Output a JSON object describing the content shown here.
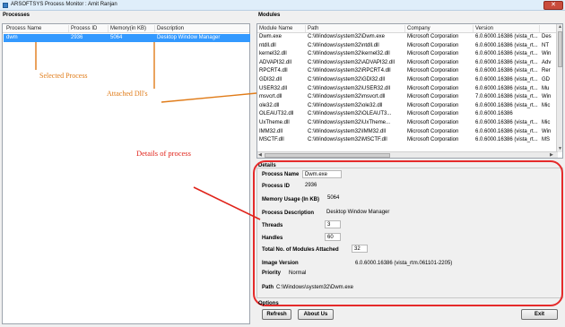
{
  "window": {
    "title": "ARSOFTSYS Process Monitor : Amit Ranjan",
    "close_label": "✕"
  },
  "processes": {
    "group_label": "Processes",
    "columns": [
      "Process Name",
      "Process ID",
      "Memory(in KB)",
      "Description"
    ],
    "rows": [
      {
        "name": "dwm",
        "pid": "2936",
        "memory": "5064",
        "description": "Desktop Window Manager",
        "selected": true
      }
    ]
  },
  "modules": {
    "group_label": "Modules",
    "columns": [
      "Module Name",
      "Path",
      "Company",
      "Version",
      ""
    ],
    "rows": [
      {
        "name": "Dwm.exe",
        "path": "C:\\Windows\\system32\\Dwm.exe",
        "company": "Microsoft Corporation",
        "version": "6.0.6000.16386 (vista_rt...",
        "extra": "Des"
      },
      {
        "name": "ntdll.dll",
        "path": "C:\\Windows\\system32\\ntdll.dll",
        "company": "Microsoft Corporation",
        "version": "6.0.6000.16386 (vista_rt...",
        "extra": "NT"
      },
      {
        "name": "kernel32.dll",
        "path": "C:\\Windows\\system32\\kernel32.dll",
        "company": "Microsoft Corporation",
        "version": "6.0.6000.16386 (vista_rt...",
        "extra": "Win"
      },
      {
        "name": "ADVAPI32.dll",
        "path": "C:\\Windows\\system32\\ADVAPI32.dll",
        "company": "Microsoft Corporation",
        "version": "6.0.6000.16386 (vista_rt...",
        "extra": "Adv"
      },
      {
        "name": "RPCRT4.dll",
        "path": "C:\\Windows\\system32\\RPCRT4.dll",
        "company": "Microsoft Corporation",
        "version": "6.0.6000.16386 (vista_rt...",
        "extra": "Rer"
      },
      {
        "name": "GDI32.dll",
        "path": "C:\\Windows\\system32\\GDI32.dll",
        "company": "Microsoft Corporation",
        "version": "6.0.6000.16386 (vista_rt...",
        "extra": "GD"
      },
      {
        "name": "USER32.dll",
        "path": "C:\\Windows\\system32\\USER32.dll",
        "company": "Microsoft Corporation",
        "version": "6.0.6000.16386 (vista_rt...",
        "extra": "Mu"
      },
      {
        "name": "msvcrt.dll",
        "path": "C:\\Windows\\system32\\msvcrt.dll",
        "company": "Microsoft Corporation",
        "version": "7.0.6000.16386 (vista_rt...",
        "extra": "Win"
      },
      {
        "name": "ole32.dll",
        "path": "C:\\Windows\\system32\\ole32.dll",
        "company": "Microsoft Corporation",
        "version": "6.0.6000.16386 (vista_rt...",
        "extra": "Mic"
      },
      {
        "name": "OLEAUT32.dll",
        "path": "C:\\Windows\\system32\\OLEAUT3...",
        "company": "Microsoft Corporation",
        "version": "6.0.6000.16386",
        "extra": ""
      },
      {
        "name": "UxTheme.dll",
        "path": "C:\\Windows\\system32\\UxTheme...",
        "company": "Microsoft Corporation",
        "version": "6.0.6000.16386 (vista_rt...",
        "extra": "Mic"
      },
      {
        "name": "IMM32.dll",
        "path": "C:\\Windows\\system32\\IMM32.dll",
        "company": "Microsoft Corporation",
        "version": "6.0.6000.16386 (vista_rt...",
        "extra": "Win"
      },
      {
        "name": "MSCTF.dll",
        "path": "C:\\Windows\\system32\\MSCTF.dll",
        "company": "Microsoft Corporation",
        "version": "6.0.6000.16386 (vista_rt...",
        "extra": "MS"
      }
    ]
  },
  "details": {
    "group_label": "Details",
    "process_name_label": "Process Name",
    "process_name": "Dwm.exe",
    "process_id_label": "Process ID",
    "process_id": "2936",
    "memory_label": "Memory Usage (In KB)",
    "memory": "5064",
    "description_label": "Process Description",
    "description": "Desktop Window Manager",
    "threads_label": "Threads",
    "threads": "3",
    "handles_label": "Handles",
    "handles": "60",
    "modules_attached_label": "Total No. of Modules Attached",
    "modules_attached": "32",
    "image_version_label": "Image Version",
    "image_version": "6.0.6000.16386 (vista_rtm.061101-2205)",
    "priority_label": "Priority",
    "priority": "Normal",
    "path_label": "Path",
    "path": "C:\\Windows\\system32\\Dwm.exe"
  },
  "options": {
    "group_label": "Options",
    "refresh_label": "Refresh",
    "about_label": "About Us",
    "exit_label": "Exit"
  },
  "annotations": {
    "selected_process": "Selected Process",
    "attached_dlls": "Attached Dll's",
    "details_of_process": "Details of process"
  },
  "colors": {
    "selection": "#3399ff",
    "annotation_orange": "#e07b18",
    "annotation_red": "#e0231a"
  }
}
